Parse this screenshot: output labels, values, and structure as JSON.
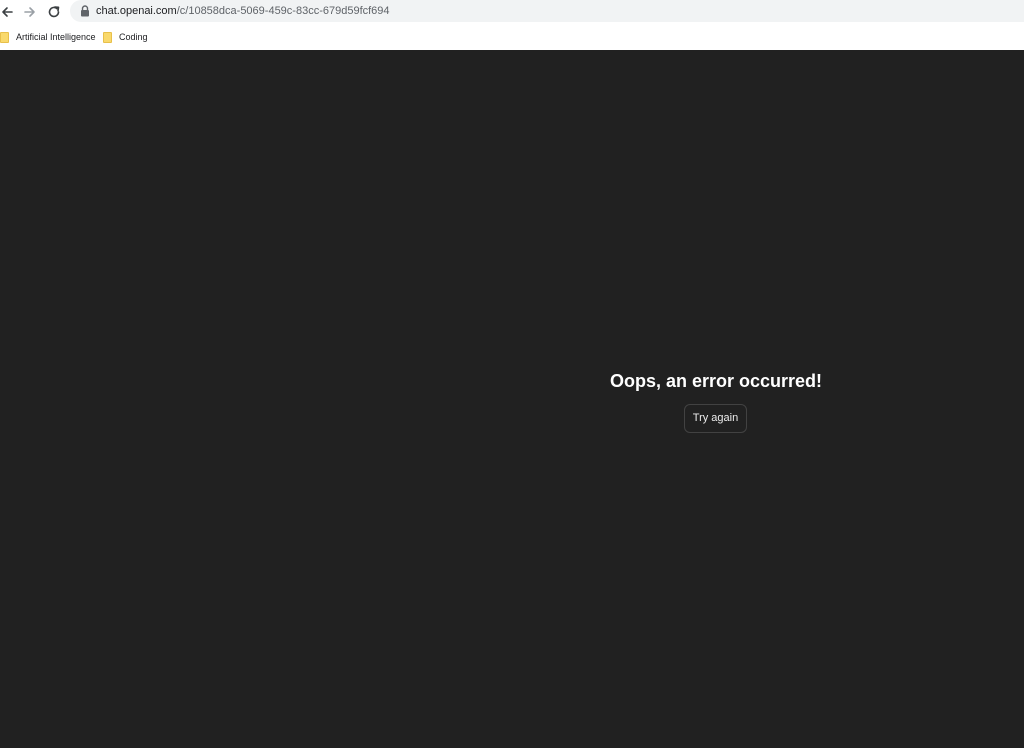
{
  "browser": {
    "url_host": "chat.openai.com",
    "url_path": "/c/10858dca-5069-459c-83cc-679d59fcf694",
    "bookmarks": [
      {
        "label": "Artificial Intelligence",
        "icon": "folder-icon"
      },
      {
        "label": "Coding",
        "icon": "folder-icon"
      }
    ]
  },
  "error": {
    "title": "Oops, an error occurred!",
    "retry_label": "Try again"
  },
  "colors": {
    "page_background": "#212121",
    "folder": "#f9d96c"
  }
}
